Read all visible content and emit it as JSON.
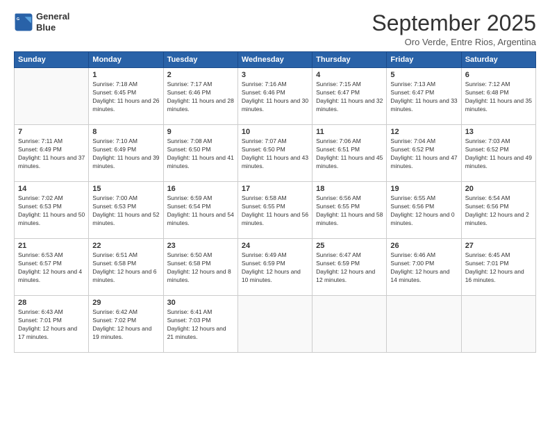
{
  "logo": {
    "line1": "General",
    "line2": "Blue"
  },
  "title": "September 2025",
  "subtitle": "Oro Verde, Entre Rios, Argentina",
  "days_of_week": [
    "Sunday",
    "Monday",
    "Tuesday",
    "Wednesday",
    "Thursday",
    "Friday",
    "Saturday"
  ],
  "weeks": [
    [
      {
        "day": "",
        "sunrise": "",
        "sunset": "",
        "daylight": ""
      },
      {
        "day": "1",
        "sunrise": "Sunrise: 7:18 AM",
        "sunset": "Sunset: 6:45 PM",
        "daylight": "Daylight: 11 hours and 26 minutes."
      },
      {
        "day": "2",
        "sunrise": "Sunrise: 7:17 AM",
        "sunset": "Sunset: 6:46 PM",
        "daylight": "Daylight: 11 hours and 28 minutes."
      },
      {
        "day": "3",
        "sunrise": "Sunrise: 7:16 AM",
        "sunset": "Sunset: 6:46 PM",
        "daylight": "Daylight: 11 hours and 30 minutes."
      },
      {
        "day": "4",
        "sunrise": "Sunrise: 7:15 AM",
        "sunset": "Sunset: 6:47 PM",
        "daylight": "Daylight: 11 hours and 32 minutes."
      },
      {
        "day": "5",
        "sunrise": "Sunrise: 7:13 AM",
        "sunset": "Sunset: 6:47 PM",
        "daylight": "Daylight: 11 hours and 33 minutes."
      },
      {
        "day": "6",
        "sunrise": "Sunrise: 7:12 AM",
        "sunset": "Sunset: 6:48 PM",
        "daylight": "Daylight: 11 hours and 35 minutes."
      }
    ],
    [
      {
        "day": "7",
        "sunrise": "Sunrise: 7:11 AM",
        "sunset": "Sunset: 6:49 PM",
        "daylight": "Daylight: 11 hours and 37 minutes."
      },
      {
        "day": "8",
        "sunrise": "Sunrise: 7:10 AM",
        "sunset": "Sunset: 6:49 PM",
        "daylight": "Daylight: 11 hours and 39 minutes."
      },
      {
        "day": "9",
        "sunrise": "Sunrise: 7:08 AM",
        "sunset": "Sunset: 6:50 PM",
        "daylight": "Daylight: 11 hours and 41 minutes."
      },
      {
        "day": "10",
        "sunrise": "Sunrise: 7:07 AM",
        "sunset": "Sunset: 6:50 PM",
        "daylight": "Daylight: 11 hours and 43 minutes."
      },
      {
        "day": "11",
        "sunrise": "Sunrise: 7:06 AM",
        "sunset": "Sunset: 6:51 PM",
        "daylight": "Daylight: 11 hours and 45 minutes."
      },
      {
        "day": "12",
        "sunrise": "Sunrise: 7:04 AM",
        "sunset": "Sunset: 6:52 PM",
        "daylight": "Daylight: 11 hours and 47 minutes."
      },
      {
        "day": "13",
        "sunrise": "Sunrise: 7:03 AM",
        "sunset": "Sunset: 6:52 PM",
        "daylight": "Daylight: 11 hours and 49 minutes."
      }
    ],
    [
      {
        "day": "14",
        "sunrise": "Sunrise: 7:02 AM",
        "sunset": "Sunset: 6:53 PM",
        "daylight": "Daylight: 11 hours and 50 minutes."
      },
      {
        "day": "15",
        "sunrise": "Sunrise: 7:00 AM",
        "sunset": "Sunset: 6:53 PM",
        "daylight": "Daylight: 11 hours and 52 minutes."
      },
      {
        "day": "16",
        "sunrise": "Sunrise: 6:59 AM",
        "sunset": "Sunset: 6:54 PM",
        "daylight": "Daylight: 11 hours and 54 minutes."
      },
      {
        "day": "17",
        "sunrise": "Sunrise: 6:58 AM",
        "sunset": "Sunset: 6:55 PM",
        "daylight": "Daylight: 11 hours and 56 minutes."
      },
      {
        "day": "18",
        "sunrise": "Sunrise: 6:56 AM",
        "sunset": "Sunset: 6:55 PM",
        "daylight": "Daylight: 11 hours and 58 minutes."
      },
      {
        "day": "19",
        "sunrise": "Sunrise: 6:55 AM",
        "sunset": "Sunset: 6:56 PM",
        "daylight": "Daylight: 12 hours and 0 minutes."
      },
      {
        "day": "20",
        "sunrise": "Sunrise: 6:54 AM",
        "sunset": "Sunset: 6:56 PM",
        "daylight": "Daylight: 12 hours and 2 minutes."
      }
    ],
    [
      {
        "day": "21",
        "sunrise": "Sunrise: 6:53 AM",
        "sunset": "Sunset: 6:57 PM",
        "daylight": "Daylight: 12 hours and 4 minutes."
      },
      {
        "day": "22",
        "sunrise": "Sunrise: 6:51 AM",
        "sunset": "Sunset: 6:58 PM",
        "daylight": "Daylight: 12 hours and 6 minutes."
      },
      {
        "day": "23",
        "sunrise": "Sunrise: 6:50 AM",
        "sunset": "Sunset: 6:58 PM",
        "daylight": "Daylight: 12 hours and 8 minutes."
      },
      {
        "day": "24",
        "sunrise": "Sunrise: 6:49 AM",
        "sunset": "Sunset: 6:59 PM",
        "daylight": "Daylight: 12 hours and 10 minutes."
      },
      {
        "day": "25",
        "sunrise": "Sunrise: 6:47 AM",
        "sunset": "Sunset: 6:59 PM",
        "daylight": "Daylight: 12 hours and 12 minutes."
      },
      {
        "day": "26",
        "sunrise": "Sunrise: 6:46 AM",
        "sunset": "Sunset: 7:00 PM",
        "daylight": "Daylight: 12 hours and 14 minutes."
      },
      {
        "day": "27",
        "sunrise": "Sunrise: 6:45 AM",
        "sunset": "Sunset: 7:01 PM",
        "daylight": "Daylight: 12 hours and 16 minutes."
      }
    ],
    [
      {
        "day": "28",
        "sunrise": "Sunrise: 6:43 AM",
        "sunset": "Sunset: 7:01 PM",
        "daylight": "Daylight: 12 hours and 17 minutes."
      },
      {
        "day": "29",
        "sunrise": "Sunrise: 6:42 AM",
        "sunset": "Sunset: 7:02 PM",
        "daylight": "Daylight: 12 hours and 19 minutes."
      },
      {
        "day": "30",
        "sunrise": "Sunrise: 6:41 AM",
        "sunset": "Sunset: 7:03 PM",
        "daylight": "Daylight: 12 hours and 21 minutes."
      },
      {
        "day": "",
        "sunrise": "",
        "sunset": "",
        "daylight": ""
      },
      {
        "day": "",
        "sunrise": "",
        "sunset": "",
        "daylight": ""
      },
      {
        "day": "",
        "sunrise": "",
        "sunset": "",
        "daylight": ""
      },
      {
        "day": "",
        "sunrise": "",
        "sunset": "",
        "daylight": ""
      }
    ]
  ]
}
